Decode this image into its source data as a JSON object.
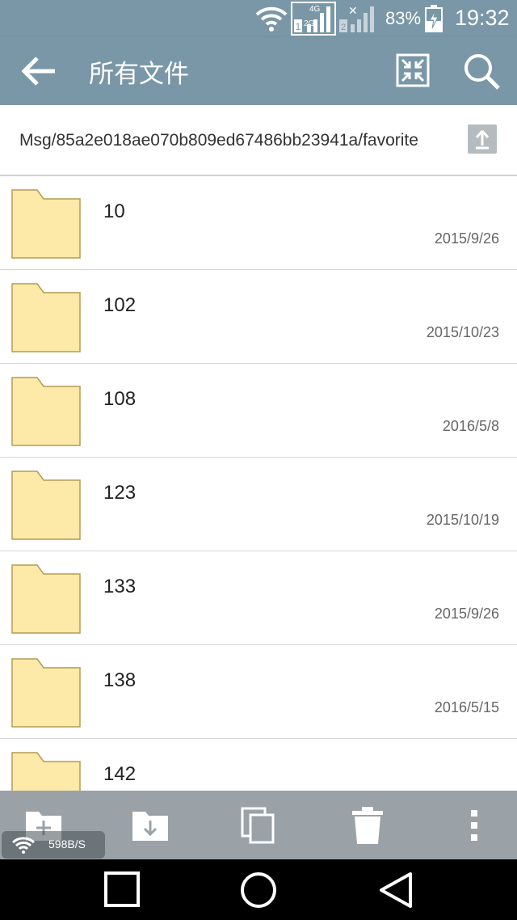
{
  "status_bar": {
    "network_4g": "4G",
    "network_2g": "2G",
    "sim1": "1",
    "sim2": "2",
    "battery_percent": "83%",
    "time": "19:32"
  },
  "app_bar": {
    "title": "所有文件"
  },
  "path_bar": {
    "path": "Msg/85a2e018ae070b809ed67486bb23941a/favorite"
  },
  "files": [
    {
      "name": "10",
      "date": "2015/9/26"
    },
    {
      "name": "102",
      "date": "2015/10/23"
    },
    {
      "name": "108",
      "date": "2016/5/8"
    },
    {
      "name": "123",
      "date": "2015/10/19"
    },
    {
      "name": "133",
      "date": "2015/9/26"
    },
    {
      "name": "138",
      "date": "2016/5/15"
    },
    {
      "name": "142",
      "date": ""
    }
  ],
  "network_speed": "598B/S",
  "colors": {
    "header": "#7a97a8",
    "folder_fill": "#fde9a8",
    "folder_stroke": "#b59a55",
    "toolbar": "#9aa2a7"
  }
}
